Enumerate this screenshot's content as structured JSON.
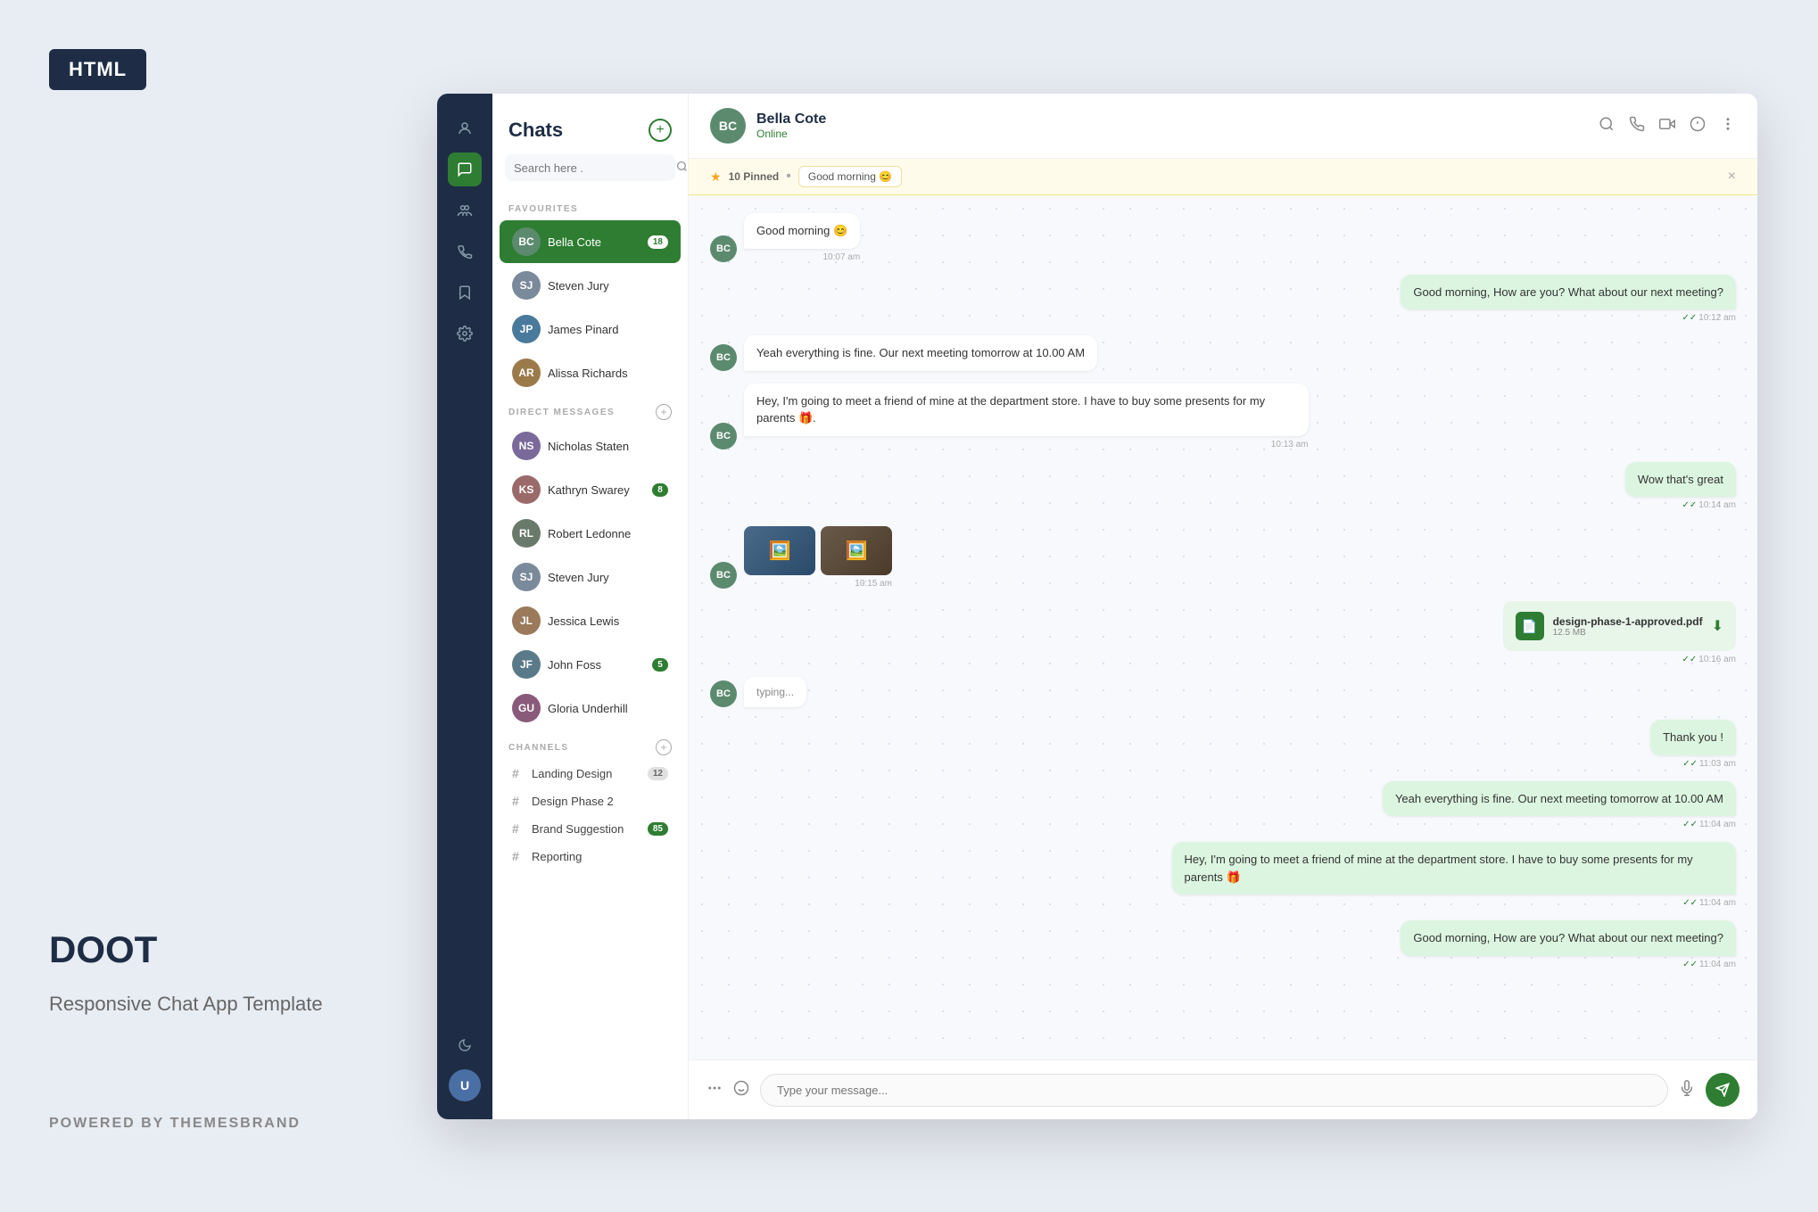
{
  "badge": {
    "label": "HTML"
  },
  "brand": {
    "title": "DOOT",
    "subtitle": "Responsive Chat App Template",
    "powered_by": "POWERED BY THEMESBRAND"
  },
  "sidebar": {
    "icons": [
      {
        "name": "profile-icon",
        "symbol": "👤",
        "active": false
      },
      {
        "name": "chat-bubble-icon",
        "symbol": "💬",
        "active": true
      },
      {
        "name": "group-icon",
        "symbol": "👥",
        "active": false
      },
      {
        "name": "phone-icon",
        "symbol": "📞",
        "active": false
      },
      {
        "name": "bookmark-icon",
        "symbol": "🔖",
        "active": false
      },
      {
        "name": "settings-icon",
        "symbol": "⚙",
        "active": false
      }
    ],
    "bottom_icons": [
      {
        "name": "moon-icon",
        "symbol": "🌙"
      }
    ],
    "avatar_initials": "U"
  },
  "chat_list": {
    "title": "Chats",
    "search_placeholder": "Search here .",
    "favourites_label": "FAVOURITES",
    "direct_messages_label": "DIRECT MESSAGES",
    "channels_label": "CHANNELS",
    "favourites": [
      {
        "name": "Bella Cote",
        "badge": "18",
        "color": "#5c8a6f",
        "initials": "BC",
        "active": true
      },
      {
        "name": "Steven Jury",
        "badge": "",
        "color": "#7a8a9a",
        "initials": "SJ",
        "active": false
      },
      {
        "name": "James Pinard",
        "badge": "",
        "color": "#4a7a9b",
        "initials": "JP",
        "active": false
      },
      {
        "name": "Alissa Richards",
        "badge": "",
        "color": "#9b7a4a",
        "initials": "AR",
        "active": false
      }
    ],
    "direct_messages": [
      {
        "name": "Nicholas Staten",
        "badge": "",
        "color": "#7a6a9a",
        "initials": "NS",
        "active": false
      },
      {
        "name": "Kathryn Swarey",
        "badge": "8",
        "color": "#9a6a6a",
        "initials": "KS",
        "active": false
      },
      {
        "name": "Robert Ledonne",
        "badge": "",
        "color": "#6a7a6a",
        "initials": "RL",
        "active": false
      },
      {
        "name": "Steven Jury",
        "badge": "",
        "color": "#7a8a9a",
        "initials": "SJ",
        "active": false
      },
      {
        "name": "Jessica Lewis",
        "badge": "",
        "color": "#9a7a5a",
        "initials": "JL",
        "active": false
      },
      {
        "name": "John Foss",
        "badge": "5",
        "color": "#5a7a8a",
        "initials": "JF",
        "active": false
      },
      {
        "name": "Gloria Underhill",
        "badge": "",
        "color": "#8a5a7a",
        "initials": "GU",
        "active": false
      }
    ],
    "channels": [
      {
        "name": "Landing Design",
        "badge": "12",
        "badge_green": false
      },
      {
        "name": "Design Phase 2",
        "badge": "",
        "badge_green": false
      },
      {
        "name": "Brand Suggestion",
        "badge": "85",
        "badge_green": true
      },
      {
        "name": "Reporting",
        "badge": "",
        "badge_green": false
      }
    ]
  },
  "chat_header": {
    "name": "Bella Cote",
    "status": "Online",
    "initials": "BC"
  },
  "pinned": {
    "count": "10 Pinned",
    "preview": "Good morning 😊",
    "close_label": "×"
  },
  "messages": [
    {
      "id": "msg1",
      "sender": "them",
      "text": "Good morning 😊",
      "time": "10:07 am",
      "type": "text"
    },
    {
      "id": "msg2",
      "sender": "me",
      "text": "Good morning, How are you? What about our next meeting?",
      "time": "10:12 am",
      "type": "text"
    },
    {
      "id": "msg3",
      "sender": "them",
      "text": "Yeah everything is fine. Our next meeting tomorrow at 10.00 AM",
      "time": "",
      "type": "text"
    },
    {
      "id": "msg4",
      "sender": "them",
      "text": "Hey, I'm going to meet a friend of mine at the department store. I have to buy some presents for my parents 🎁.",
      "time": "10:13 am",
      "type": "text"
    },
    {
      "id": "msg5",
      "sender": "me",
      "text": "Wow that's great",
      "time": "10:14 am",
      "type": "text"
    },
    {
      "id": "msg6",
      "sender": "them",
      "text": "",
      "time": "10:15 am",
      "type": "images"
    },
    {
      "id": "msg7",
      "sender": "me",
      "text": "",
      "time": "10:16 am",
      "type": "file",
      "file_name": "design-phase-1-approved.pdf",
      "file_size": "12.5 MB"
    },
    {
      "id": "msg8",
      "sender": "them",
      "text": "typing...",
      "time": "",
      "type": "typing"
    },
    {
      "id": "msg9",
      "sender": "me",
      "text": "Thank you !",
      "time": "11:03 am",
      "type": "text"
    },
    {
      "id": "msg10",
      "sender": "me",
      "text": "Yeah everything is fine. Our next meeting tomorrow at 10.00 AM",
      "time": "11:04 am",
      "type": "text"
    },
    {
      "id": "msg11",
      "sender": "me",
      "text": "Hey, I'm going to meet a friend of mine at the department store. I have to buy some presents for my parents 🎁",
      "time": "11:04 am",
      "type": "text"
    },
    {
      "id": "msg12",
      "sender": "me",
      "text": "Good morning, How are you? What about our next meeting?",
      "time": "11:04 am",
      "type": "text"
    }
  ],
  "input": {
    "placeholder": "Type your message..."
  }
}
